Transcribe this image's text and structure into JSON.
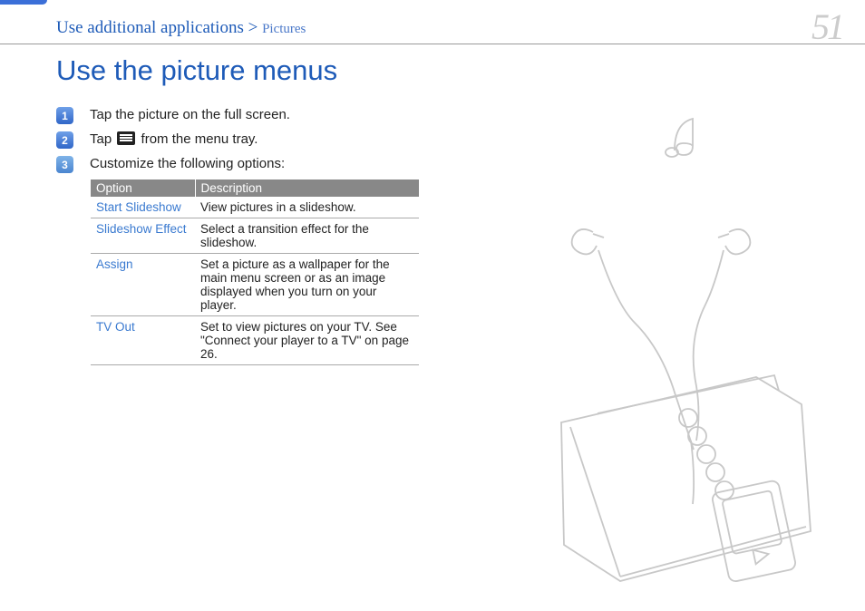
{
  "breadcrumb": {
    "main": "Use additional applications > ",
    "sub": "Pictures"
  },
  "page_number": "51",
  "heading": "Use the picture menus",
  "steps": [
    {
      "num": "1",
      "text_a": "Tap the picture on the full screen."
    },
    {
      "num": "2",
      "text_a": "Tap ",
      "text_b": " from the menu tray."
    },
    {
      "num": "3",
      "text_a": "Customize the following options:"
    }
  ],
  "table": {
    "headers": {
      "col1": "Option",
      "col2": "Description"
    },
    "rows": [
      {
        "option": "Start Slideshow",
        "description": "View pictures in a slideshow."
      },
      {
        "option": "Slideshow Effect",
        "description": "Select a transition effect for the slideshow."
      },
      {
        "option": "Assign",
        "description": "Set a picture as a wallpaper for the main menu screen or as an image displayed when you turn on your player."
      },
      {
        "option": "TV Out",
        "description": "Set to view pictures on your TV. See \"Connect your player to a TV\" on page 26."
      }
    ]
  }
}
